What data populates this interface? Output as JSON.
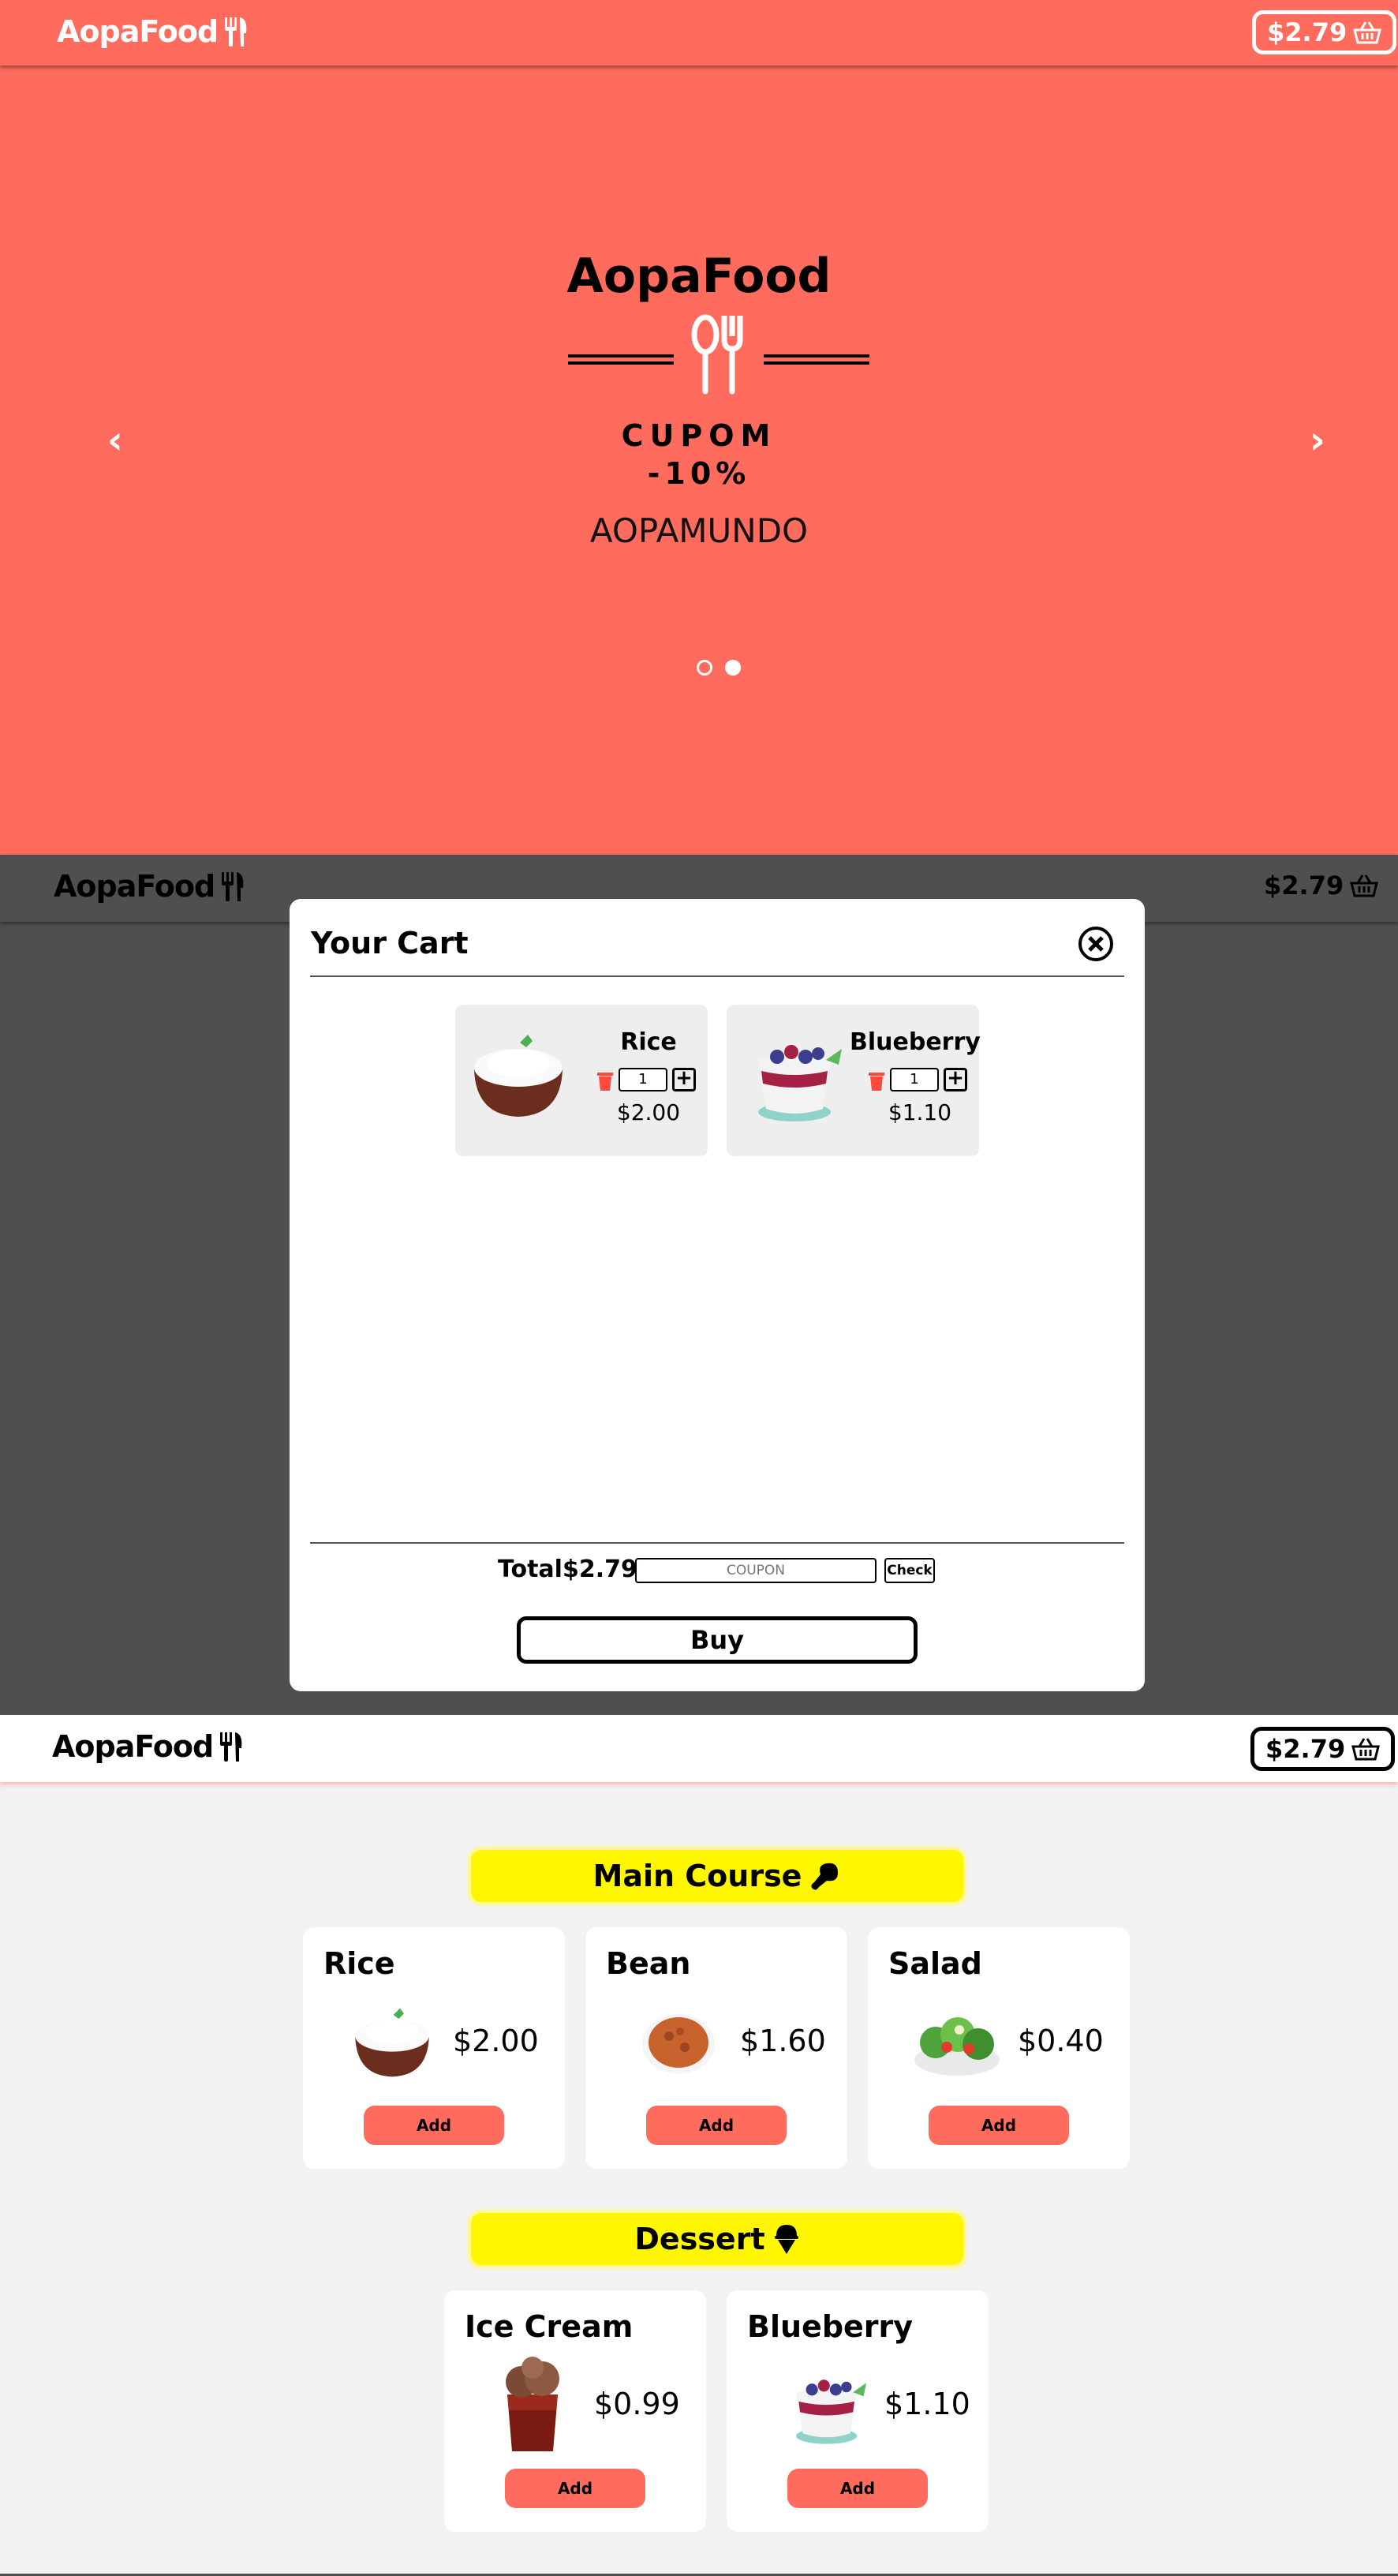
{
  "brand": "AopaFood",
  "cart_total": "$2.79",
  "hero": {
    "title": "AopaFood",
    "coupon_line1": "CUPOM",
    "coupon_line2": "-10%",
    "coupon_code": "AOPAMUNDO",
    "prev_icon": "chevron-left-icon",
    "next_icon": "chevron-right-icon",
    "slide_index": 2,
    "slide_count": 2
  },
  "cart_modal": {
    "title": "Your Cart",
    "items": [
      {
        "name": "Rice",
        "qty": "1",
        "price": "$2.00"
      },
      {
        "name": "Blueberry",
        "qty": "1",
        "price": "$1.10"
      }
    ],
    "total_label": "Total",
    "total_value": "$2.79",
    "coupon_placeholder": "COUPON",
    "check_label": "Check",
    "buy_label": "Buy"
  },
  "menu": {
    "categories": [
      {
        "title": "Main Course",
        "icon": "drumstick-icon",
        "items": [
          {
            "name": "Rice",
            "price": "$2.00",
            "add": "Add"
          },
          {
            "name": "Bean",
            "price": "$1.60",
            "add": "Add"
          },
          {
            "name": "Salad",
            "price": "$0.40",
            "add": "Add"
          }
        ]
      },
      {
        "title": "Dessert",
        "icon": "ice-cream-icon",
        "items": [
          {
            "name": "Ice Cream",
            "price": "$0.99",
            "add": "Add"
          },
          {
            "name": "Blueberry",
            "price": "$1.10",
            "add": "Add"
          }
        ]
      }
    ]
  },
  "colors": {
    "accent": "#ff6b5d",
    "highlight": "#fff700",
    "overlay": "#4f4f4f"
  }
}
